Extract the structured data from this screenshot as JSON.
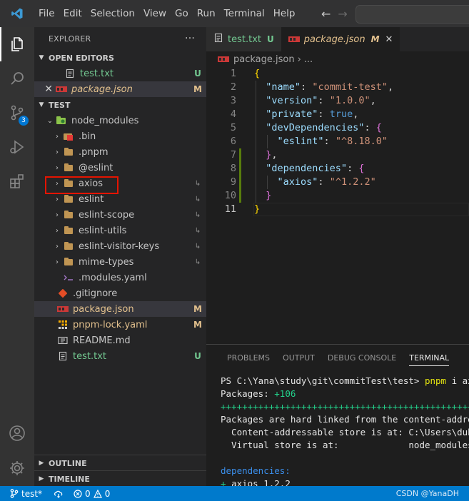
{
  "menu": [
    "File",
    "Edit",
    "Selection",
    "View",
    "Go",
    "Run",
    "Terminal",
    "Help"
  ],
  "activity_badge": "3",
  "explorer": {
    "title": "EXPLORER",
    "more": "···",
    "open_editors_title": "OPEN EDITORS",
    "open_editors": [
      {
        "label": "test.txt",
        "status": "U"
      },
      {
        "label": "package.json",
        "status": "M"
      }
    ],
    "project_title": "TEST",
    "tree": [
      {
        "label": "node_modules"
      },
      {
        "label": ".bin"
      },
      {
        "label": ".pnpm"
      },
      {
        "label": "@eslint"
      },
      {
        "label": "axios"
      },
      {
        "label": "eslint"
      },
      {
        "label": "eslint-scope"
      },
      {
        "label": "eslint-utils"
      },
      {
        "label": "eslint-visitor-keys"
      },
      {
        "label": "mime-types"
      },
      {
        "label": ".modules.yaml"
      },
      {
        "label": ".gitignore"
      },
      {
        "label": "package.json",
        "status": "M"
      },
      {
        "label": "pnpm-lock.yaml",
        "status": "M"
      },
      {
        "label": "README.md"
      },
      {
        "label": "test.txt",
        "status": "U"
      }
    ],
    "outline_title": "OUTLINE",
    "timeline_title": "TIMELINE"
  },
  "tabs": [
    {
      "label": "test.txt",
      "status": "U"
    },
    {
      "label": "package.json",
      "status": "M"
    }
  ],
  "breadcrumb": {
    "file": "package.json",
    "rest": "..."
  },
  "editor": {
    "line_numbers": [
      "1",
      "2",
      "3",
      "4",
      "5",
      "6",
      "7",
      "8",
      "9",
      "10",
      "11"
    ],
    "lines": [
      [
        {
          "t": "{",
          "c": "b1"
        }
      ],
      [
        {
          "t": "  "
        },
        {
          "t": "\"name\"",
          "c": "k"
        },
        {
          "t": ": ",
          "c": "p"
        },
        {
          "t": "\"commit-test\"",
          "c": "s"
        },
        {
          "t": ",",
          "c": "p"
        }
      ],
      [
        {
          "t": "  "
        },
        {
          "t": "\"version\"",
          "c": "k"
        },
        {
          "t": ": ",
          "c": "p"
        },
        {
          "t": "\"1.0.0\"",
          "c": "s"
        },
        {
          "t": ",",
          "c": "p"
        }
      ],
      [
        {
          "t": "  "
        },
        {
          "t": "\"private\"",
          "c": "k"
        },
        {
          "t": ": ",
          "c": "p"
        },
        {
          "t": "true",
          "c": "kw"
        },
        {
          "t": ",",
          "c": "p"
        }
      ],
      [
        {
          "t": "  "
        },
        {
          "t": "\"devDependencies\"",
          "c": "k"
        },
        {
          "t": ": ",
          "c": "p"
        },
        {
          "t": "{",
          "c": "b2"
        }
      ],
      [
        {
          "t": "    "
        },
        {
          "t": "\"eslint\"",
          "c": "k"
        },
        {
          "t": ": ",
          "c": "p"
        },
        {
          "t": "\"^8.18.0\"",
          "c": "s"
        }
      ],
      [
        {
          "t": "  "
        },
        {
          "t": "}",
          "c": "b2"
        },
        {
          "t": ",",
          "c": "p"
        }
      ],
      [
        {
          "t": "  "
        },
        {
          "t": "\"dependencies\"",
          "c": "k"
        },
        {
          "t": ": ",
          "c": "p"
        },
        {
          "t": "{",
          "c": "b2"
        }
      ],
      [
        {
          "t": "    "
        },
        {
          "t": "\"axios\"",
          "c": "k"
        },
        {
          "t": ": ",
          "c": "p"
        },
        {
          "t": "\"^1.2.2\"",
          "c": "s"
        }
      ],
      [
        {
          "t": "  "
        },
        {
          "t": "}",
          "c": "b2"
        }
      ],
      [
        {
          "t": "}",
          "c": "b1"
        }
      ]
    ]
  },
  "panel": {
    "tabs": [
      "PROBLEMS",
      "OUTPUT",
      "DEBUG CONSOLE",
      "TERMINAL"
    ],
    "terminal": [
      [
        {
          "t": "PS C:\\Yana\\study\\git\\commitTest\\test> ",
          "c": "twhite"
        },
        {
          "t": "pnpm",
          "c": "tyellow"
        },
        {
          "t": " i axios",
          "c": "twhite"
        }
      ],
      [
        {
          "t": "Packages: ",
          "c": "twhite"
        },
        {
          "t": "+106",
          "c": "tgreen"
        }
      ],
      [
        {
          "t": "++++++++++++++++++++++++++++++++++++++++++++++++++++++++++++",
          "c": "tgreen"
        }
      ],
      [
        {
          "t": "Packages are hard linked from the content-addressable store",
          "c": "twhite"
        }
      ],
      [
        {
          "t": "  Content-addressable store is at: C:\\Users\\duhuan",
          "c": "twhite"
        }
      ],
      [
        {
          "t": "  Virtual store is at:             node_modules/.pnpm",
          "c": "twhite"
        }
      ],
      [
        {
          "t": ""
        }
      ],
      [
        {
          "t": "dependencies:",
          "c": "tblue"
        }
      ],
      [
        {
          "t": "+ ",
          "c": "tgreen"
        },
        {
          "t": "axios 1.2.2",
          "c": "twhite"
        }
      ]
    ]
  },
  "status": {
    "branch": "test*",
    "errors": "0",
    "warnings": "0",
    "watermark": "CSDN @YanaDH"
  },
  "colors": {
    "accent": "#007acc",
    "added": "#73c991",
    "modified": "#e2c08d",
    "highlight_box": "#e51400"
  }
}
